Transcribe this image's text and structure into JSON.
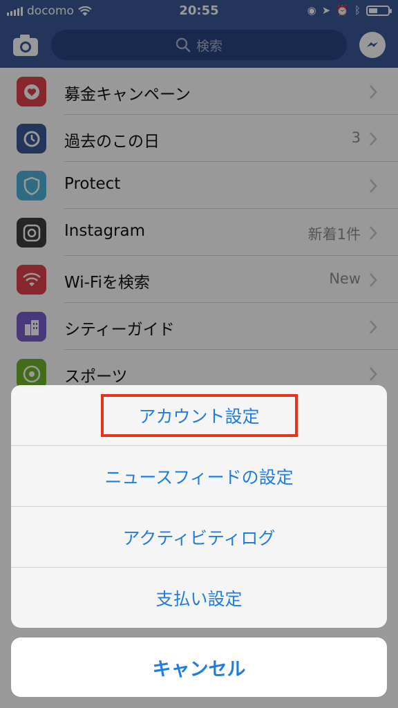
{
  "status_bar": {
    "carrier": "docomo",
    "time": "20:55"
  },
  "header": {
    "search_placeholder": "検索"
  },
  "menu_items": [
    {
      "label": "募金キャンペーン",
      "detail": "",
      "icon": "heart-icon",
      "color": "#e0424b"
    },
    {
      "label": "過去のこの日",
      "detail": "3",
      "icon": "clock-history-icon",
      "color": "#3b5998"
    },
    {
      "label": "Protect",
      "detail": "",
      "icon": "shield-icon",
      "color": "#4fb3d9"
    },
    {
      "label": "Instagram",
      "detail": "新着1件",
      "icon": "instagram-icon",
      "color": "#3f3f3f"
    },
    {
      "label": "Wi-Fiを検索",
      "detail": "New",
      "icon": "wifi-icon",
      "color": "#e0424b"
    },
    {
      "label": "シティーガイド",
      "detail": "",
      "icon": "city-icon",
      "color": "#7b5fc9"
    },
    {
      "label": "スポーツ",
      "detail": "",
      "icon": "sports-icon",
      "color": "#6fb52c"
    }
  ],
  "action_sheet": {
    "options": [
      "アカウント設定",
      "ニュースフィードの設定",
      "アクティビティログ",
      "支払い設定"
    ],
    "cancel": "キャンセル"
  },
  "colors": {
    "brand": "#3b5998",
    "action": "#1f7ce0",
    "highlight": "#e8331c"
  }
}
